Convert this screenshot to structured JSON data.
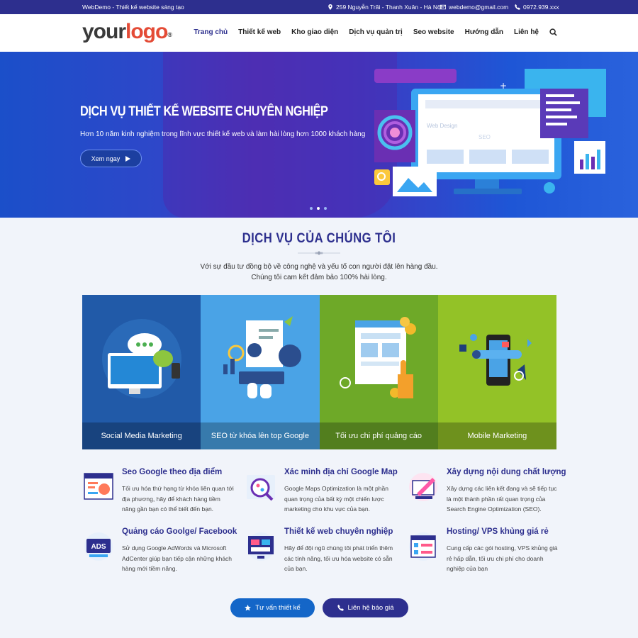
{
  "topbar": {
    "tagline": "WebDemo - Thiết kế website sáng tạo",
    "address": "259 Nguyễn Trãi - Thanh Xuân - Hà Nội",
    "email": "webdemo@gmail.com",
    "phone": "0972.939.xxx"
  },
  "logo": {
    "part1": "your",
    "part2": "logo",
    "mark": "®"
  },
  "nav": [
    "Trang chủ",
    "Thiết kế web",
    "Kho giao diện",
    "Dịch vụ quản trị",
    "Seo website",
    "Hướng dẫn",
    "Liên hệ"
  ],
  "hero": {
    "title": "DỊCH VỤ THIẾT KẾ WEBSITE CHUYÊN NGHIỆP",
    "subtitle": "Hơn 10 năm kinh nghiệm trong lĩnh vực thiết kế web và làm hài lòng hơn 1000 khách hàng",
    "button": "Xem ngay",
    "art_text1": "Web Design",
    "art_text2": "SEO"
  },
  "services": {
    "title": "DỊCH VỤ CỦA CHÚNG TÔI",
    "line1": "Với sự đầu tư đồng bộ về công nghệ và yếu tố con người đặt lên hàng đầu.",
    "line2": "Chúng tôi cam kết đảm bảo 100% hài lòng."
  },
  "cards": [
    {
      "label": "Social Media Marketing",
      "color": "#215aa8"
    },
    {
      "label": "SEO từ khóa lên top Google",
      "color": "#4aa3e6"
    },
    {
      "label": "Tối ưu chi phí quảng cáo",
      "color": "#6ea928"
    },
    {
      "label": "Mobile Marketing",
      "color": "#93c227"
    }
  ],
  "features": [
    {
      "title": "Seo Google theo địa điểm",
      "desc": "Tối ưu hóa thứ hạng từ khóa liên quan tới địa phương, hãy để khách hàng tiềm năng gần bạn có thể biết đến bạn."
    },
    {
      "title": "Xác minh địa chỉ Google Map",
      "desc": "Google Maps Optimization là một phần quan trọng của bất kỳ một chiến lược marketing cho khu vực của bạn."
    },
    {
      "title": "Xây dựng nội dung chất lượng",
      "desc": "Xây dựng các liên kết đang và sẽ tiếp tục là một thành phần rất quan trọng của Search Engine Optimization (SEO)."
    },
    {
      "title": "Quảng cáo Goolge/ Facebook",
      "desc": "Sử dụng Google AdWords và Microsoft AdCenter giúp bạn tiếp cận những khách hàng mới tiềm năng."
    },
    {
      "title": "Thiết kế web chuyên nghiệp",
      "desc": "Hãy để đội ngũ chúng tôi phát triển thêm các tính năng, tối ưu hóa website có sẵn của bạn."
    },
    {
      "title": "Hosting/ VPS khủng giá rẻ",
      "desc": "Cung cấp các gói hosting, VPS khủng giá rẻ hấp dẫn, tối ưu chi phí cho doanh nghiệp của bạn"
    }
  ],
  "ads_icon_text": "ADS",
  "cta": {
    "consult": "Tư vấn thiết kế",
    "quote": "Liên hệ báo giá",
    "consult_color": "#1466c8",
    "quote_color": "#2d2f8e"
  }
}
